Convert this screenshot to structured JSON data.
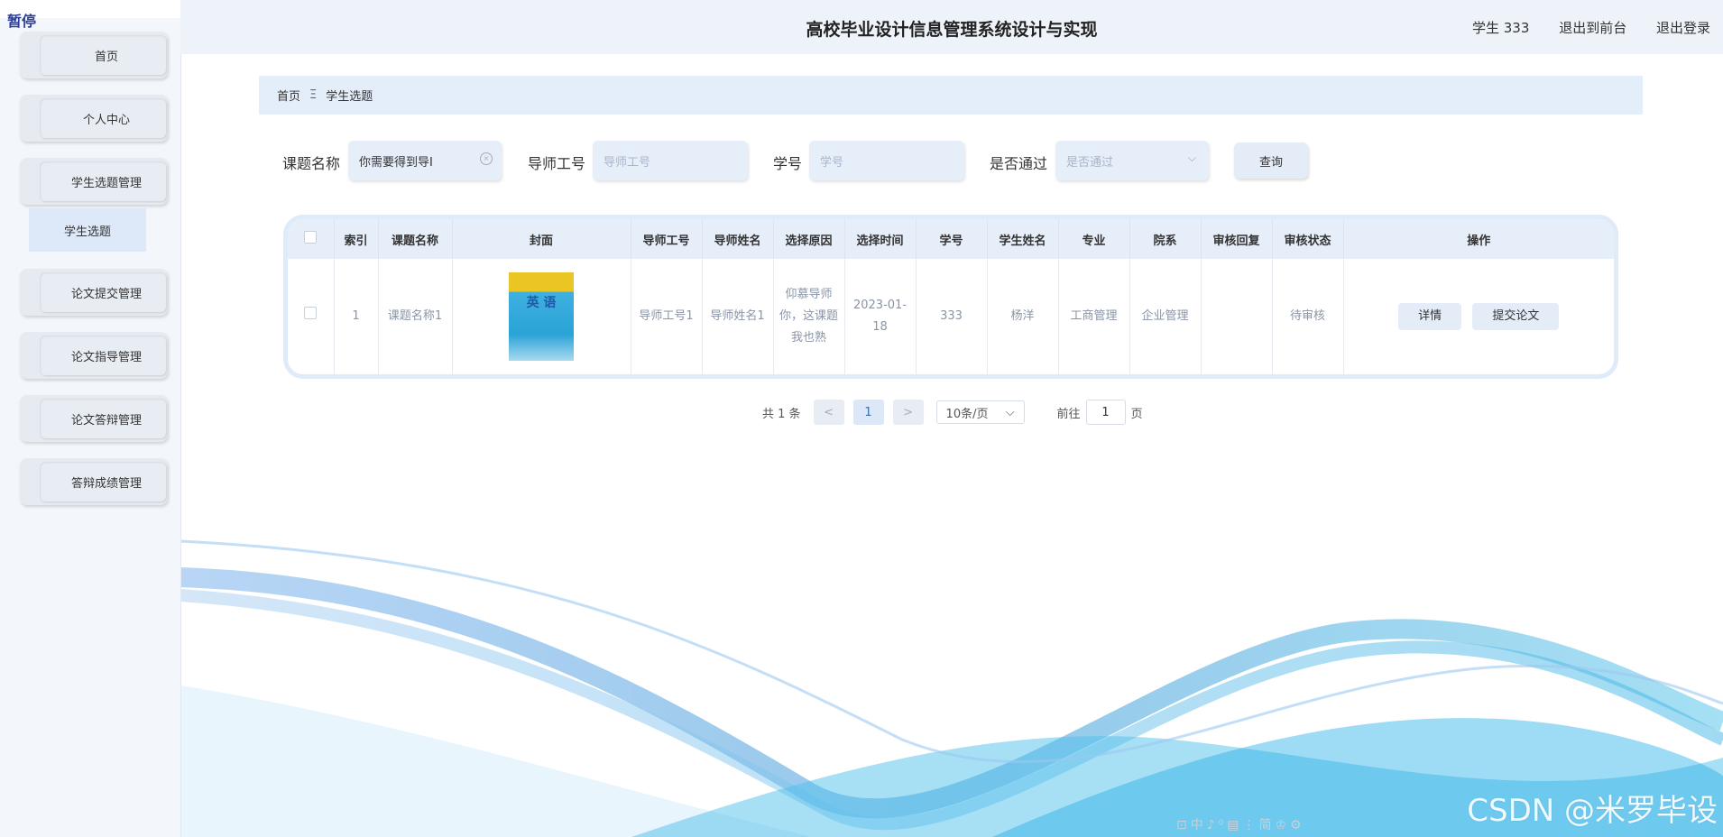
{
  "sidebar": {
    "pause_label": "暂停",
    "items": [
      {
        "label": "首页"
      },
      {
        "label": "个人中心"
      },
      {
        "label": "学生选题管理"
      },
      {
        "label": "论文提交管理"
      },
      {
        "label": "论文指导管理"
      },
      {
        "label": "论文答辩管理"
      },
      {
        "label": "答辩成绩管理"
      }
    ],
    "sub_item": "学生选题"
  },
  "header": {
    "title": "高校毕业设计信息管理系统设计与实现",
    "user": "学生 333",
    "back_front": "退出到前台",
    "logout": "退出登录"
  },
  "breadcrumb": {
    "home": "首页",
    "sep": "Ξ",
    "current": "学生选题"
  },
  "search": {
    "topic_label": "课题名称",
    "topic_value": "你需要得到导I",
    "teacher_id_label": "导师工号",
    "teacher_id_placeholder": "导师工号",
    "student_id_label": "学号",
    "student_id_placeholder": "学号",
    "passed_label": "是否通过",
    "passed_placeholder": "是否通过",
    "query_button": "查询"
  },
  "table": {
    "headers": [
      "索引",
      "课题名称",
      "封面",
      "导师工号",
      "导师姓名",
      "选择原因",
      "选择时间",
      "学号",
      "学生姓名",
      "专业",
      "院系",
      "审核回复",
      "审核状态",
      "操作"
    ],
    "rows": [
      {
        "index": "1",
        "topic": "课题名称1",
        "cover_text": "英 语",
        "teacher_id": "导师工号1",
        "teacher_name": "导师姓名1",
        "reason": "仰慕导师你，这课题我也熟",
        "time": "2023-01-18",
        "student_id": "333",
        "student_name": "杨洋",
        "major": "工商管理",
        "department": "企业管理",
        "reply": "",
        "status": "待审核",
        "detail_button": "详情",
        "submit_button": "提交论文"
      }
    ]
  },
  "pagination": {
    "total": "共 1 条",
    "prev": "<",
    "current": "1",
    "next": ">",
    "page_size": "10条/页",
    "goto_label": "前往",
    "goto_value": "1",
    "page_unit": "页"
  },
  "watermark": "CSDN @米罗毕设",
  "ime_bar": "⊡中♪⁰▤⋮简♔⚙"
}
